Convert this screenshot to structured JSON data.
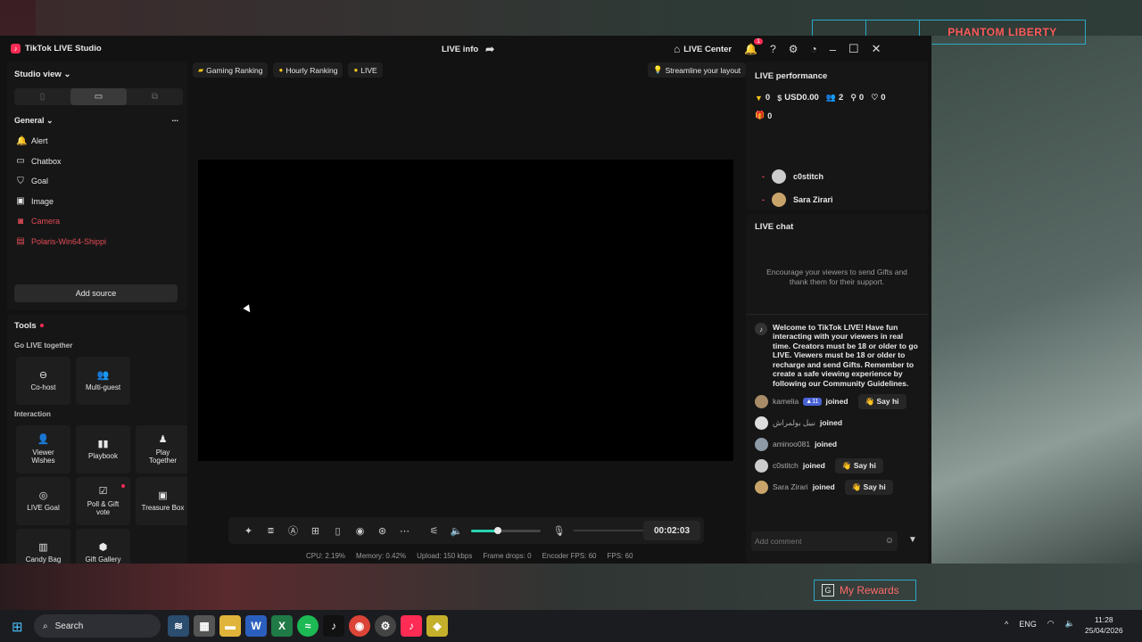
{
  "desktop": {
    "game_title": "PHANTOM LIBERTY",
    "rewards_label": "My Rewards",
    "rewards_key": "G"
  },
  "window": {
    "app_title": "TikTok LIVE Studio",
    "live_info": "LIVE info",
    "live_center": "LIVE Center",
    "notifications_count": "1"
  },
  "sidebar": {
    "studio_view": "Studio view",
    "general_label": "General",
    "more_label": "...",
    "sources": [
      {
        "label": "Alert",
        "icon": "bell-icon",
        "glyph": "🔔",
        "active": false
      },
      {
        "label": "Chatbox",
        "icon": "chat-icon",
        "glyph": "▭",
        "active": false
      },
      {
        "label": "Goal",
        "icon": "shield-icon",
        "glyph": "⛉",
        "active": false
      },
      {
        "label": "Image",
        "icon": "image-icon",
        "glyph": "▣",
        "active": false
      },
      {
        "label": "Camera",
        "icon": "camera-icon",
        "glyph": "◙",
        "active": true
      },
      {
        "label": "Polaris-Win64-Shippi",
        "icon": "window-icon",
        "glyph": "▤",
        "active": true
      }
    ],
    "add_source": "Add source"
  },
  "tools": {
    "title": "Tools",
    "go_live_together": "Go LIVE together",
    "interaction": "Interaction",
    "items": {
      "cohost": "Co-host",
      "multiguest": "Multi-guest",
      "viewer_wishes": "Viewer Wishes",
      "playbook": "Playbook",
      "play_together": "Play Together",
      "live_goal": "LIVE Goal",
      "poll_gift_vote": "Poll & Gift vote",
      "treasure_box": "Treasure Box",
      "candy_bag": "Candy Bag",
      "gift_gallery": "Gift Gallery"
    }
  },
  "center": {
    "chips": {
      "gaming_ranking": "Gaming Ranking",
      "hourly_ranking": "Hourly Ranking",
      "live": "LIVE"
    },
    "streamline": "Streamline your layout",
    "timer": "00:02:03",
    "volume_level": 0.38,
    "stats": {
      "cpu": "CPU: 2.19%",
      "memory": "Memory: 0.42%",
      "upload": "Upload: 150 kbps",
      "frame_drops": "Frame drops: 0",
      "encoder_fps": "Encoder FPS: 60",
      "fps": "FPS: 60"
    }
  },
  "performance": {
    "title": "LIVE performance",
    "diamonds": "0",
    "usd": "USD0.00",
    "viewers": "2",
    "new_followers": "0",
    "likes": "0",
    "gifters": "0",
    "top_viewers": [
      "c0stitch",
      "Sara Zirari"
    ]
  },
  "chat": {
    "title": "LIVE chat",
    "encourage": "Encourage your viewers to send Gifts and thank them for their support.",
    "welcome": "Welcome to TikTok LIVE! Have fun interacting with your viewers in real time. Creators must be 18 or older to go LIVE. Viewers must be 18 or older to recharge and send Gifts. Remember to create a safe viewing experience by following our Community Guidelines.",
    "joined_word": "joined",
    "say_hi": "Say hi",
    "events": [
      {
        "name": "kamelia",
        "level": "11"
      },
      {
        "name": "نبيل بولمراش"
      },
      {
        "name": "aminoo081"
      },
      {
        "name": "c0stitch"
      },
      {
        "name": "Sara Zirari"
      }
    ],
    "comment_placeholder": "Add comment"
  },
  "taskbar": {
    "search": "Search",
    "language": "ENG",
    "time": "11:28",
    "date": "25/04/2026"
  }
}
